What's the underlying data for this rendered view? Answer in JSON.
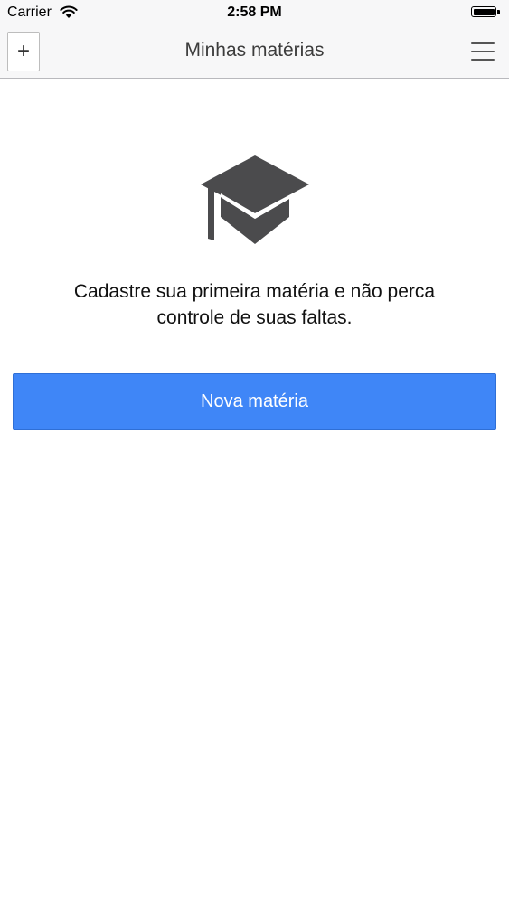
{
  "status_bar": {
    "carrier": "Carrier",
    "time": "2:58 PM",
    "wifi_icon": "wifi-icon",
    "battery_icon": "battery-icon"
  },
  "nav": {
    "add_label": "+",
    "title": "Minhas matérias",
    "menu_icon": "hamburger-menu-icon"
  },
  "empty_state": {
    "icon": "graduation-cap-icon",
    "message_line1": "Cadastre sua primeira matéria e não perca",
    "message_line2": "controle de suas faltas.",
    "button_label": "Nova matéria"
  },
  "colors": {
    "accent": "#3f86f7",
    "icon": "#4b4b4d",
    "nav_background": "#f7f7f8"
  }
}
